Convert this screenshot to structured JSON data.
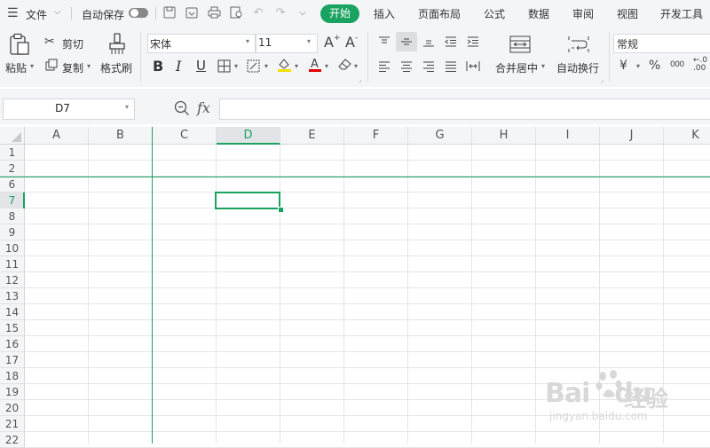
{
  "menu": {
    "file_label": "文件",
    "autosave_label": "自动保存",
    "tabs": [
      "开始",
      "插入",
      "页面布局",
      "公式",
      "数据",
      "审阅",
      "视图",
      "开发工具"
    ]
  },
  "ribbon": {
    "paste": "粘贴",
    "cut": "剪切",
    "copy": "复制",
    "format_painter": "格式刷",
    "font_name": "宋体",
    "font_size": "11",
    "merge_center": "合并居中",
    "wrap_text": "自动换行",
    "number_format": "常规",
    "currency_symbol": "¥",
    "percent_symbol": "%",
    "thousands_symbol": "000"
  },
  "formula_bar": {
    "name_box": "D7",
    "fx": "fx",
    "formula": ""
  },
  "grid": {
    "columns": [
      "A",
      "B",
      "C",
      "D",
      "E",
      "F",
      "G",
      "H",
      "I",
      "J",
      "K"
    ],
    "rows": [
      "1",
      "2",
      "6",
      "7",
      "8",
      "9",
      "10",
      "11",
      "12",
      "13",
      "14",
      "15",
      "16",
      "17",
      "18",
      "19",
      "20",
      "21",
      "22"
    ],
    "selected_cell": "D7",
    "accent_color": "#1aa260"
  },
  "watermark": {
    "brand": "Bai",
    "brand2": "du",
    "brand_cn": "经验",
    "url": "jingyan.baidu.com"
  }
}
